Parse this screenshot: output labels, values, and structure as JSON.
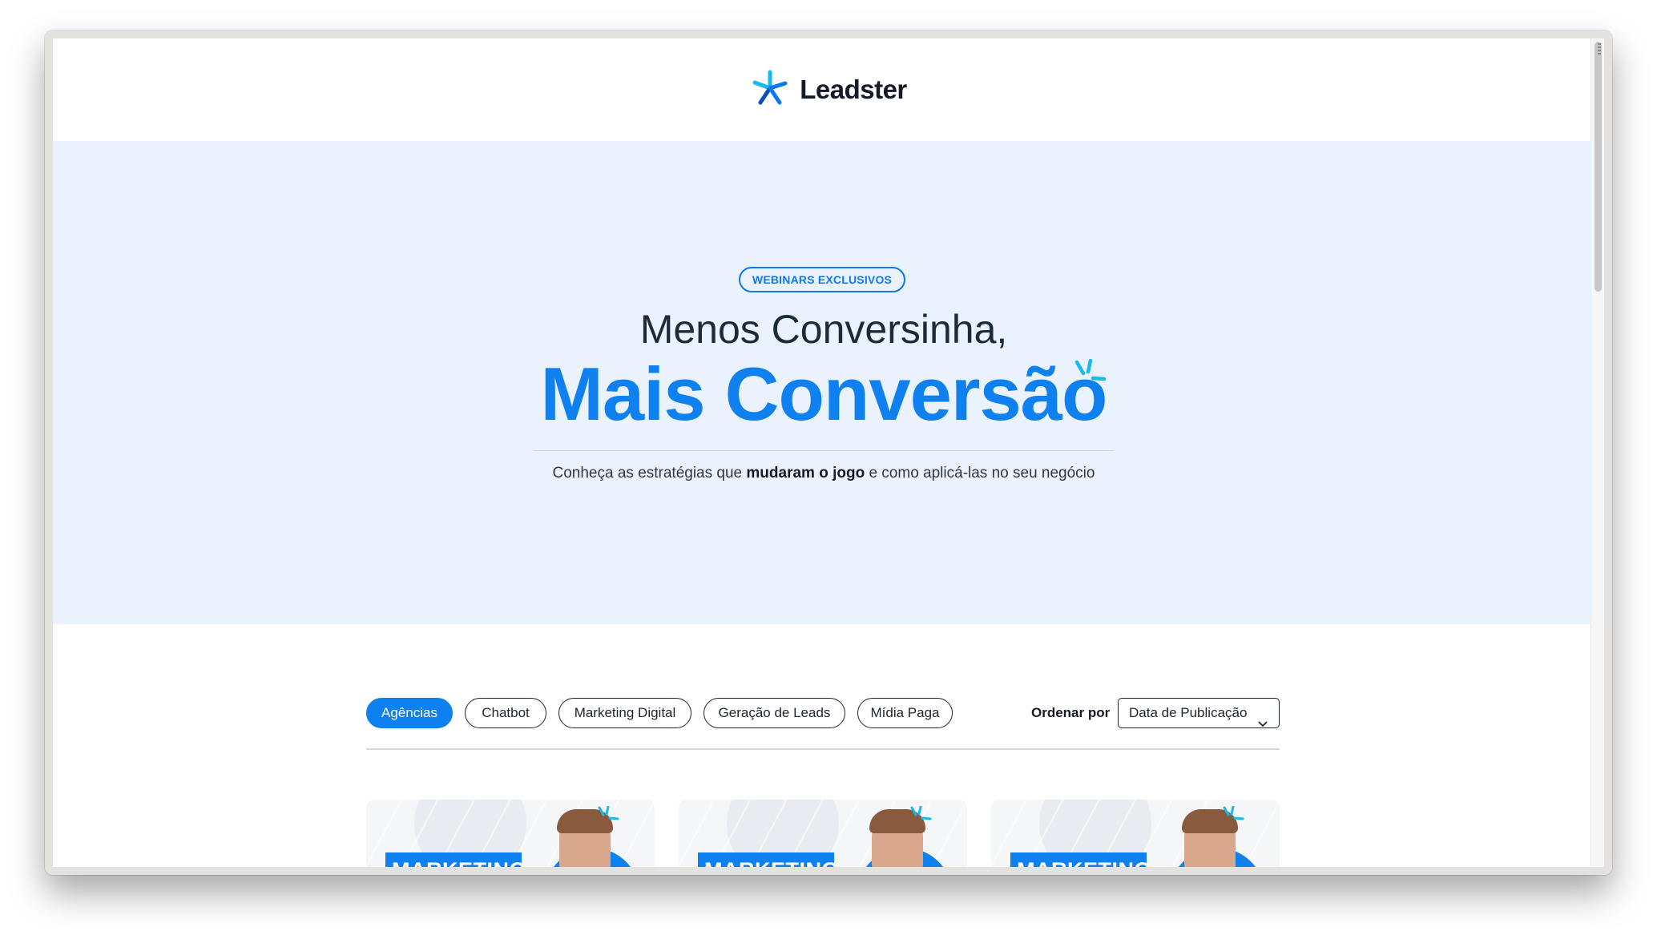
{
  "brand": {
    "name": "Leadster",
    "accent": "#0f80ef",
    "dark": "#141a26"
  },
  "hero": {
    "badge": "WEBINARS EXCLUSIVOS",
    "title_line1": "Menos Conversinha,",
    "title_line2": "Mais Conversão",
    "subtitle_pre": "Conheça as estratégias que ",
    "subtitle_bold": "mudaram o jogo",
    "subtitle_post": " e como aplicá-las no seu negócio",
    "background": "#eaf3fd"
  },
  "filters": {
    "chips": [
      {
        "label": "Agências",
        "active": true
      },
      {
        "label": "Chatbot",
        "active": false
      },
      {
        "label": "Marketing Digital",
        "active": false
      },
      {
        "label": "Geração de Leads",
        "active": false
      },
      {
        "label": "Mídia Paga",
        "active": false
      }
    ],
    "order_label": "Ordenar por",
    "order_value": "Data de Publicação"
  },
  "cards": [
    {
      "tag": "MARKETING"
    },
    {
      "tag": "MARKETING"
    },
    {
      "tag": "MARKETING"
    }
  ],
  "icons": {
    "logo": "leadster-spark-icon",
    "select": "chevron-down-icon",
    "decor": "sparkle-icon"
  }
}
